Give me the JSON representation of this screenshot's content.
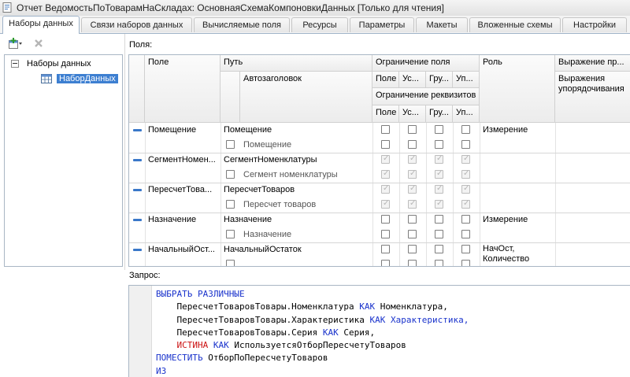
{
  "window": {
    "title": "Отчет ВедомостьПоТоварамНаСкладах: ОсновнаяСхемаКомпоновкиДанных [Только для чтения]"
  },
  "tabs": [
    {
      "label": "Наборы данных",
      "active": true
    },
    {
      "label": "Связи наборов данных"
    },
    {
      "label": "Вычисляемые поля"
    },
    {
      "label": "Ресурсы"
    },
    {
      "label": "Параметры"
    },
    {
      "label": "Макеты"
    },
    {
      "label": "Вложенные схемы"
    },
    {
      "label": "Настройки"
    }
  ],
  "datasets": {
    "root_label": "Наборы данных",
    "items": [
      "НаборДанных"
    ]
  },
  "fields": {
    "caption": "Поля:",
    "headers": {
      "field": "Поле",
      "path": "Путь",
      "autotitle": "Автозаголовок",
      "restriction": "Ограничение поля",
      "restriction_cols": [
        "Поле",
        "Ус...",
        "Гру...",
        "Уп..."
      ],
      "attr_restriction": "Ограничение реквизитов",
      "attr_cols": [
        "Поле",
        "Ус...",
        "Гру...",
        "Уп..."
      ],
      "role": "Роль",
      "expression": "Выражение пр...",
      "order_expr": "Выражения упорядочивания"
    },
    "rows": [
      {
        "field": "Помещение",
        "path": "Помещение",
        "title": "Помещение",
        "role": "Измерение",
        "checked": false
      },
      {
        "field": "СегментНомен...",
        "path": "СегментНоменклатуры",
        "title": "Сегмент номенклатуры",
        "role": "",
        "checked": true
      },
      {
        "field": "ПересчетТова...",
        "path": "ПересчетТоваров",
        "title": "Пересчет товаров",
        "role": "",
        "checked": true
      },
      {
        "field": "Назначение",
        "path": "Назначение",
        "title": "Назначение",
        "role": "Измерение",
        "checked": false
      },
      {
        "field": "НачальныйОст...",
        "path": "НачальныйОстаток",
        "title": "",
        "role": "НачОст, Количество",
        "checked": false
      }
    ]
  },
  "query": {
    "caption": "Запрос:",
    "lines": [
      [
        {
          "t": "ВЫБРАТЬ РАЗЛИЧНЫЕ",
          "c": "kw"
        }
      ],
      [
        {
          "t": "    ПересчетТоваровТовары.Номенклатура ",
          "c": "txt"
        },
        {
          "t": "КАК",
          "c": "kw"
        },
        {
          "t": " Номенклатура,",
          "c": "txt"
        }
      ],
      [
        {
          "t": "    ПересчетТоваровТовары.Характеристика ",
          "c": "txt"
        },
        {
          "t": "КАК Характеристика,",
          "c": "kw"
        }
      ],
      [
        {
          "t": "    ПересчетТоваровТовары.Серия ",
          "c": "txt"
        },
        {
          "t": "КАК",
          "c": "kw"
        },
        {
          "t": " Серия,",
          "c": "txt"
        }
      ],
      [
        {
          "t": "    ",
          "c": "txt"
        },
        {
          "t": "ИСТИНА",
          "c": "red"
        },
        {
          "t": " ",
          "c": "txt"
        },
        {
          "t": "КАК",
          "c": "kw"
        },
        {
          "t": " ИспользуетсяОтборПересчетуТоваров",
          "c": "txt"
        }
      ],
      [
        {
          "t": "ПОМЕСТИТЬ",
          "c": "kw"
        },
        {
          "t": " ОтборПоПересчетуТоваров",
          "c": "txt"
        }
      ],
      [
        {
          "t": "ИЗ",
          "c": "kw"
        }
      ]
    ]
  }
}
